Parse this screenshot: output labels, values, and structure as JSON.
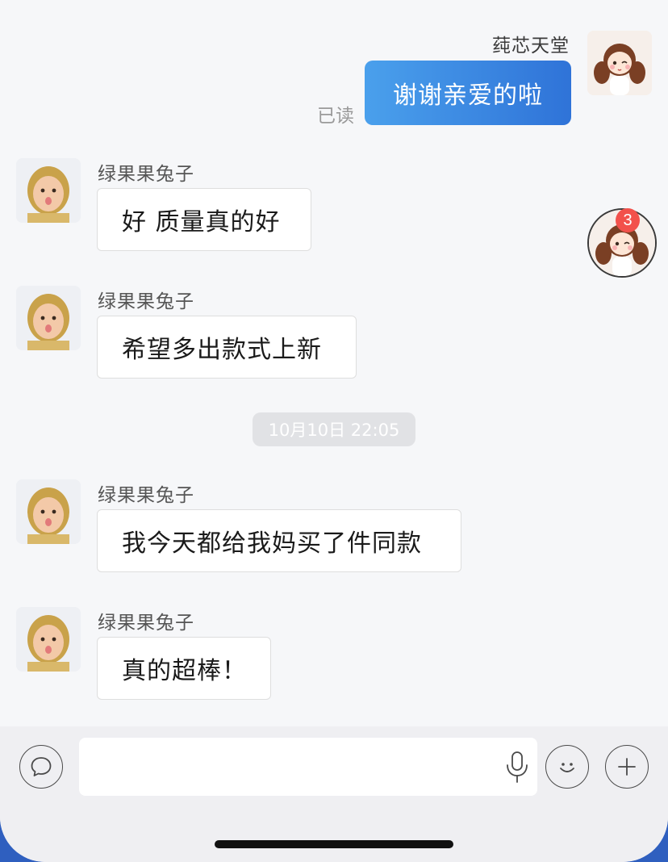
{
  "chat": {
    "sent_message": {
      "sender": "莼芯天堂",
      "text": "谢谢亲爱的啦",
      "status": "已读"
    },
    "received_messages_1": [
      {
        "sender": "绿果果兔子",
        "text": "好 质量真的好"
      },
      {
        "sender": "绿果果兔子",
        "text": "希望多出款式上新"
      }
    ],
    "timestamp": "10月10日 22:05",
    "received_messages_2": [
      {
        "sender": "绿果果兔子",
        "text": "我今天都给我妈买了件同款"
      },
      {
        "sender": "绿果果兔子",
        "text": "真的超棒！"
      }
    ],
    "floating_badge_count": "3"
  },
  "input_bar": {
    "placeholder": "",
    "left_icon": "chat-bubble-icon",
    "mic_icon": "microphone-icon",
    "emoji_icon": "smiley-icon",
    "plus_icon": "plus-icon"
  },
  "colors": {
    "sent_bubble_start": "#4aa0ec",
    "sent_bubble_end": "#2f73d8",
    "badge": "#f2514b",
    "background": "#f6f7f9"
  }
}
